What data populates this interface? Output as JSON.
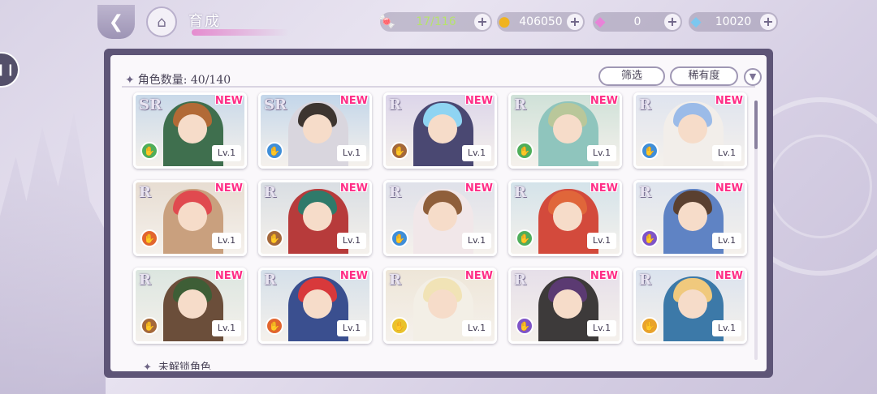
{
  "header": {
    "title": "育成",
    "back_icon": "back-arrow-icon",
    "home_icon": "castle-home-icon"
  },
  "resources": {
    "candy": {
      "value": "17/116",
      "icon": "candy-icon",
      "color": "#b6e36c"
    },
    "coin": {
      "value": "406050",
      "icon": "coin-icon"
    },
    "pink_gem": {
      "value": "0",
      "icon": "pink-gem-icon"
    },
    "diamond": {
      "value": "10020",
      "icon": "diamond-icon"
    }
  },
  "panel": {
    "count_label": "角色数量: 40/140",
    "filter_label": "筛选",
    "rarity_label": "稀有度",
    "locked_section_label": "未解锁角色"
  },
  "cards": [
    {
      "rarity": "SR",
      "new": "NEW",
      "level": "Lv.1",
      "attr_color": "#4fae5a",
      "bg": "#c9d9e9",
      "hair": "#b26a36",
      "outfit": "#3f6f4e"
    },
    {
      "rarity": "SR",
      "new": "NEW",
      "level": "Lv.1",
      "attr_color": "#3f8ed8",
      "bg": "#c3d6ea",
      "hair": "#3d3530",
      "outfit": "#d9d6de"
    },
    {
      "rarity": "R",
      "new": "NEW",
      "level": "Lv.1",
      "attr_color": "#a4683a",
      "bg": "#dcd5ea",
      "hair": "#8fd4f2",
      "outfit": "#4a4872"
    },
    {
      "rarity": "R",
      "new": "NEW",
      "level": "Lv.1",
      "attr_color": "#4fae5a",
      "bg": "#cfe1d8",
      "hair": "#b9c79a",
      "outfit": "#8fc5bd"
    },
    {
      "rarity": "R",
      "new": "NEW",
      "level": "Lv.1",
      "attr_color": "#3f8ed8",
      "bg": "#dfe4ef",
      "hair": "#9bbbe8",
      "outfit": "#f2eeea"
    },
    {
      "rarity": "R",
      "new": "NEW",
      "level": "Lv.1",
      "attr_color": "#e2652e",
      "bg": "#e7ddd2",
      "hair": "#e04a4f",
      "outfit": "#c9a07e"
    },
    {
      "rarity": "R",
      "new": "NEW",
      "level": "Lv.1",
      "attr_color": "#a4683a",
      "bg": "#d9dee3",
      "hair": "#2f7a6a",
      "outfit": "#b73b3b"
    },
    {
      "rarity": "R",
      "new": "NEW",
      "level": "Lv.1",
      "attr_color": "#3f8ed8",
      "bg": "#dfe1ea",
      "hair": "#8f5f3b",
      "outfit": "#f1e7e9"
    },
    {
      "rarity": "R",
      "new": "NEW",
      "level": "Lv.1",
      "attr_color": "#4fae5a",
      "bg": "#d4e3ea",
      "hair": "#e0663a",
      "outfit": "#d34a3c"
    },
    {
      "rarity": "R",
      "new": "NEW",
      "level": "Lv.1",
      "attr_color": "#7f54c7",
      "bg": "#dfe5ee",
      "hair": "#5a4030",
      "outfit": "#5f83c4"
    },
    {
      "rarity": "R",
      "new": "NEW",
      "level": "Lv.1",
      "attr_color": "#a4683a",
      "bg": "#dce6e0",
      "hair": "#3e5e36",
      "outfit": "#6b4e3a"
    },
    {
      "rarity": "R",
      "new": "NEW",
      "level": "Lv.1",
      "attr_color": "#e2652e",
      "bg": "#d5e0ea",
      "hair": "#d8393b",
      "outfit": "#3a4f8f"
    },
    {
      "rarity": "R",
      "new": "NEW",
      "level": "Lv.1",
      "attr_color": "#e9c22c",
      "bg": "#eee6d8",
      "hair": "#f1e3b6",
      "outfit": "#f3efe6"
    },
    {
      "rarity": "R",
      "new": "NEW",
      "level": "Lv.1",
      "attr_color": "#7f54c7",
      "bg": "#e6dfe9",
      "hair": "#5b3a72",
      "outfit": "#3d3a3a"
    },
    {
      "rarity": "R",
      "new": "NEW",
      "level": "Lv.1",
      "attr_color": "#e9a32c",
      "bg": "#dbe3ee",
      "hair": "#f0c97d",
      "outfit": "#3c79a8"
    }
  ]
}
